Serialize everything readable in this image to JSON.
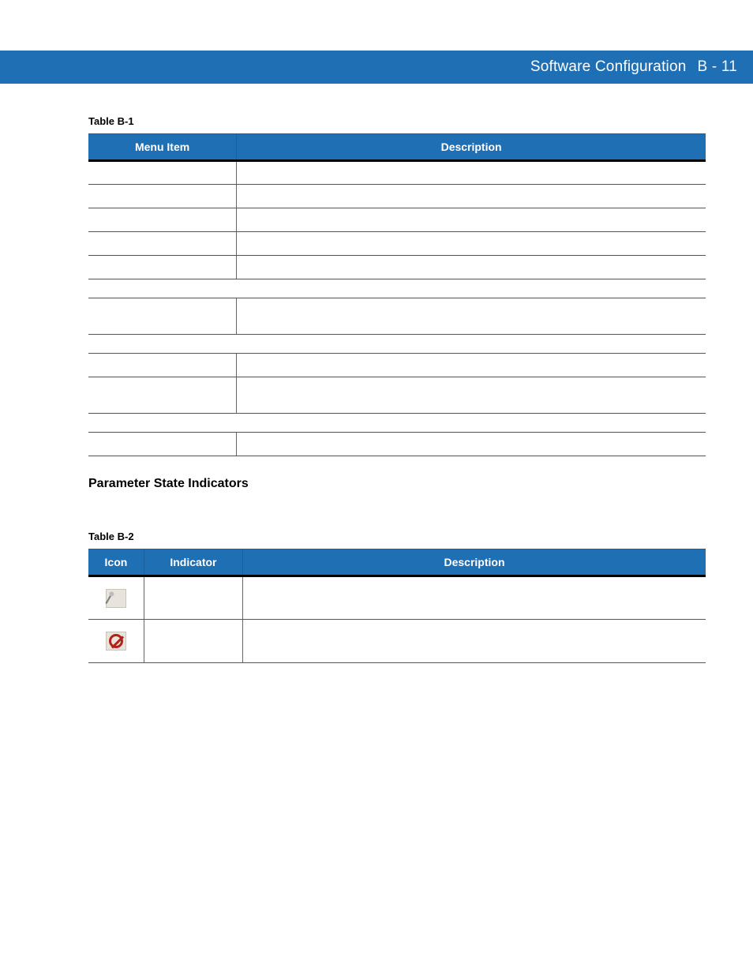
{
  "header": {
    "section": "Software Configuration",
    "page": "B - 11"
  },
  "table1": {
    "caption": "Table B-1",
    "headers": {
      "col1": "Menu Item",
      "col2": "Description"
    },
    "rows": [
      {
        "type": "row",
        "height": "h1",
        "c1": " ",
        "c2": " "
      },
      {
        "type": "row",
        "height": "h1",
        "c1": " ",
        "c2": " "
      },
      {
        "type": "row",
        "height": "h1",
        "c1": " ",
        "c2": " "
      },
      {
        "type": "row",
        "height": "h1",
        "c1": " ",
        "c2": " "
      },
      {
        "type": "row",
        "height": "h1",
        "c1": " ",
        "c2": " "
      },
      {
        "type": "spacer"
      },
      {
        "type": "row",
        "height": "h2",
        "c1": " ",
        "c2": " "
      },
      {
        "type": "spacer"
      },
      {
        "type": "row",
        "height": "h1",
        "c1": " ",
        "c2": " "
      },
      {
        "type": "row",
        "height": "h2",
        "c1": " ",
        "c2": " "
      },
      {
        "type": "spacer"
      },
      {
        "type": "row",
        "height": "h1",
        "c1": " ",
        "c2": " "
      }
    ]
  },
  "sectionHeading": "Parameter State Indicators",
  "table2": {
    "caption": "Table B-2",
    "headers": {
      "col1": "Icon",
      "col2": "Indicator",
      "col3": "Description"
    },
    "rows": [
      {
        "icon": "wand",
        "indicator": " ",
        "description": " "
      },
      {
        "icon": "prohibit",
        "indicator": " ",
        "description": " "
      }
    ]
  }
}
